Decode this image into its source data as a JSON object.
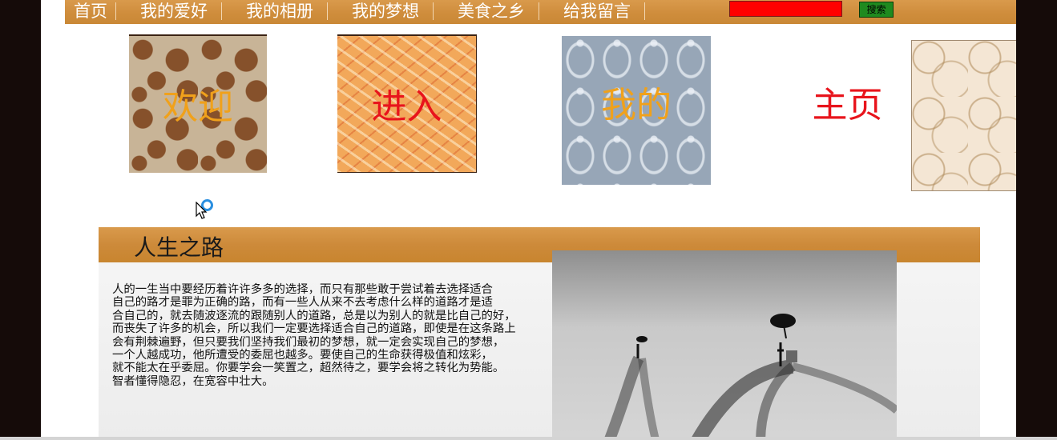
{
  "nav": {
    "items": [
      {
        "label": "首页"
      },
      {
        "label": "我的爱好"
      },
      {
        "label": "我的相册"
      },
      {
        "label": "我的梦想"
      },
      {
        "label": "美食之乡"
      },
      {
        "label": "给我留言"
      }
    ],
    "search_value": "",
    "search_button": "搜索"
  },
  "tiles": [
    {
      "text": "欢迎",
      "color": "#f0a11b"
    },
    {
      "text": "进入",
      "color": "#e8141c"
    },
    {
      "text": "我的",
      "color": "#f0a11b"
    },
    {
      "text": "主页",
      "color": "#e8141c"
    }
  ],
  "section": {
    "title": "人生之路",
    "lines": [
      "人的一生当中要经历着许许多多的选择，而只有那些敢于尝试着去选择适合",
      "自己的路才是罪为正确的路，而有一些人从来不去考虑什么样的道路才是适",
      "合自己的，就去随波逐流的跟随别人的道路，总是以为别人的就是比自己的好，",
      "而丧失了许多的机会，所以我们一定要选择适合自己的道路，即使是在这条路上",
      "会有荆棘遍野，但只要我们坚持我们最初的梦想，就一定会实现自己的梦想，",
      "一个人越成功，他所遭受的委屈也越多。要使自己的生命获得极值和炫彩，",
      "就不能太在乎委屈。你要学会一笑置之，超然待之，要学会将之转化为势能。",
      "智者懂得隐忍，在宽容中壮大。"
    ]
  },
  "colors": {
    "accent": "#cf8d3c",
    "search_input": "#ff0000",
    "search_button": "#1f8a1f",
    "frame": "#150b09"
  }
}
